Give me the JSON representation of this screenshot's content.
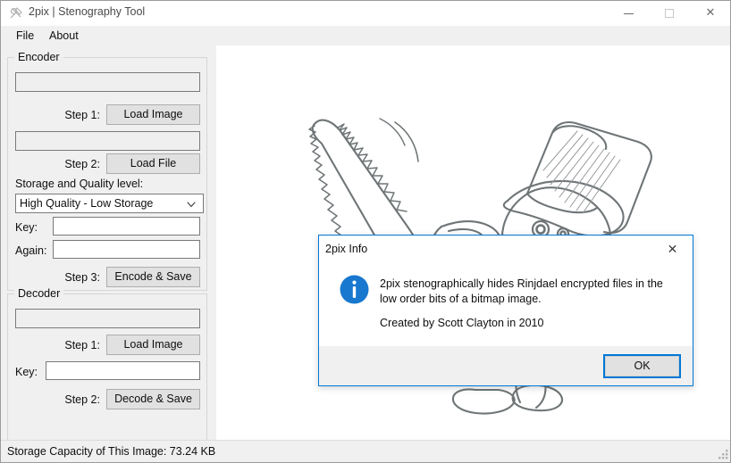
{
  "window": {
    "title": "2pix | Stenography Tool",
    "icon": "app-icon",
    "controls": {
      "minimize": "—",
      "maximize": "",
      "close": "✕"
    }
  },
  "menu": {
    "items": [
      {
        "label": "File"
      },
      {
        "label": "About"
      }
    ]
  },
  "encoder": {
    "group_title": "Encoder",
    "image_path_value": "",
    "image_path_placeholder": "",
    "step1_label": "Step 1:",
    "step1_button": "Load Image",
    "file_path_value": "",
    "file_path_placeholder": "",
    "step2_label": "Step 2:",
    "step2_button": "Load File",
    "quality_label": "Storage and Quality level:",
    "quality_selected": "High Quality - Low Storage",
    "quality_options": [
      "High Quality - Low Storage"
    ],
    "key_label": "Key:",
    "key_value": "",
    "again_label": "Again:",
    "again_value": "",
    "step3_label": "Step 3:",
    "step3_button": "Encode & Save"
  },
  "decoder": {
    "group_title": "Decoder",
    "image_path_value": "",
    "image_path_placeholder": "",
    "step1_label": "Step 1:",
    "step1_button": "Load Image",
    "key_label": "Key:",
    "key_value": "",
    "step2_label": "Step 2:",
    "step2_button": "Decode & Save"
  },
  "preview": {
    "description": "pencil sketch of a snowman wearing a top hat holding a chainsaw"
  },
  "statusbar": {
    "text": "Storage Capacity of This Image: 73.24 KB",
    "grip": "resize-grip"
  },
  "dialog": {
    "title": "2pix Info",
    "close_glyph": "✕",
    "icon": "info-icon",
    "icon_glyph": "i",
    "message_line1": "2pix stenographically hides Rinjdael encrypted files in the low order bits of a bitmap image.",
    "message_line2": "Created by Scott Clayton in 2010",
    "ok_button": "OK"
  },
  "colors": {
    "accent": "#0078d7",
    "info_blue": "#1878cf",
    "chrome": "#f0f0f0",
    "button_face": "#e1e1e1",
    "text": "#0e0e0e"
  }
}
